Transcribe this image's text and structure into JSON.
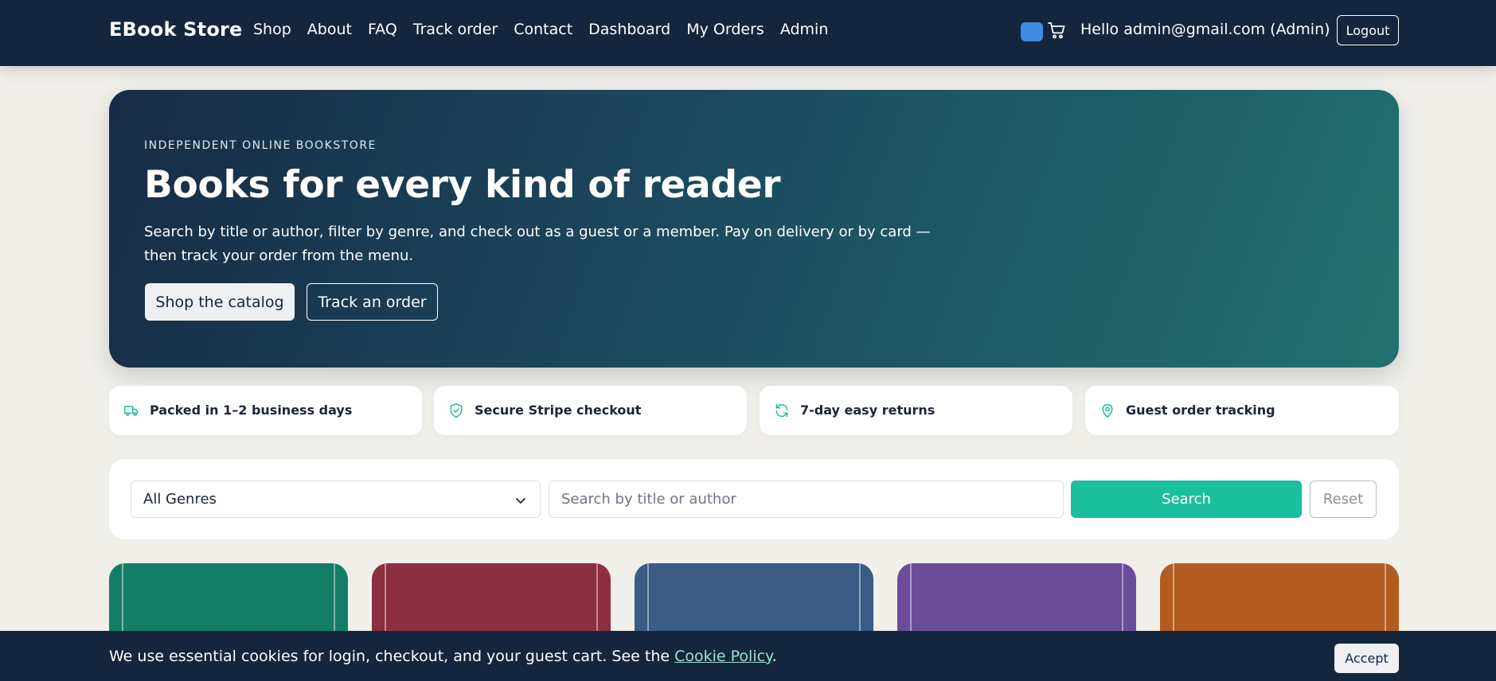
{
  "brand": "EBook Store",
  "nav": {
    "links": [
      "Shop",
      "About",
      "FAQ",
      "Track order",
      "Contact",
      "Dashboard",
      "My Orders",
      "Admin"
    ],
    "greeting": "Hello admin@gmail.com (Admin)",
    "logout_label": "Logout",
    "cart_icon": "cart-icon"
  },
  "hero": {
    "eyebrow": "INDEPENDENT ONLINE BOOKSTORE",
    "title": "Books for every kind of reader",
    "subtitle": "Search by title or author, filter by genre, and check out as a guest or a member. Pay on delivery or by card — then track your order from the menu.",
    "primary_button": "Shop the catalog",
    "secondary_button": "Track an order"
  },
  "features": [
    {
      "icon": "truck-icon",
      "label": "Packed in 1–2 business days"
    },
    {
      "icon": "shield-check-icon",
      "label": "Secure Stripe checkout"
    },
    {
      "icon": "refresh-icon",
      "label": "7-day easy returns"
    },
    {
      "icon": "map-pin-icon",
      "label": "Guest order tracking"
    }
  ],
  "search": {
    "genre_selected": "All Genres",
    "input_value": "",
    "placeholder": "Search by title or author",
    "search_label": "Search",
    "reset_label": "Reset"
  },
  "books": [
    {
      "color": "#137e66"
    },
    {
      "color": "#8c2f3e"
    },
    {
      "color": "#3a5b83"
    },
    {
      "color": "#6b4c9a"
    },
    {
      "color": "#b45c1f"
    }
  ],
  "cookie": {
    "text": "We use essential cookies for login, checkout, and your guest cart. See the ",
    "link": "Cookie Policy",
    "suffix": ".",
    "accept_label": "Accept"
  },
  "colors": {
    "navbar": "#14263d",
    "accent": "#1bbf9b",
    "page_background": "#f1efea"
  }
}
